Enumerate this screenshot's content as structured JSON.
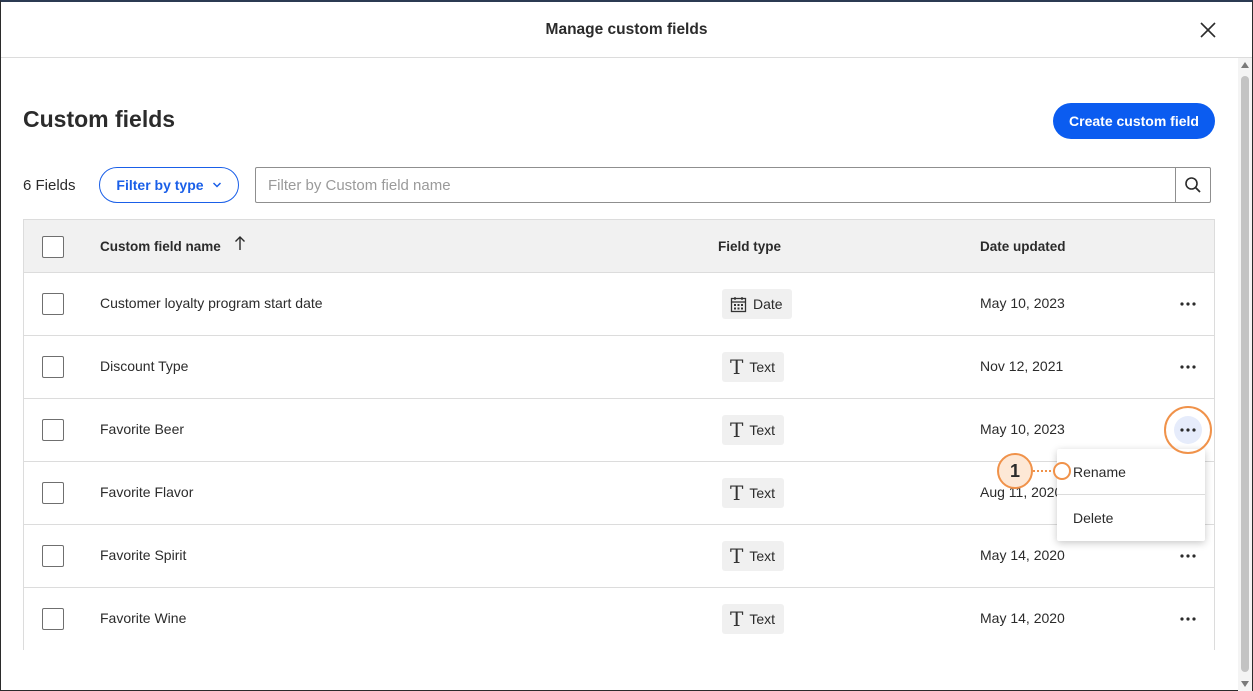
{
  "dialog": {
    "title": "Manage custom fields"
  },
  "page": {
    "title": "Custom fields",
    "create_label": "Create custom field",
    "field_count": "6 Fields",
    "filter_type_label": "Filter by type",
    "search_placeholder": "Filter by Custom field name"
  },
  "table": {
    "headers": {
      "name": "Custom field name",
      "type": "Field type",
      "date": "Date updated"
    },
    "rows": [
      {
        "name": "Customer loyalty program start date",
        "type": "Date",
        "type_icon": "calendar-icon",
        "date": "May 10, 2023"
      },
      {
        "name": "Discount Type",
        "type": "Text",
        "type_icon": "text-icon",
        "date": "Nov 12, 2021"
      },
      {
        "name": "Favorite Beer",
        "type": "Text",
        "type_icon": "text-icon",
        "date": "May 10, 2023"
      },
      {
        "name": "Favorite Flavor",
        "type": "Text",
        "type_icon": "text-icon",
        "date": "Aug 11, 2020"
      },
      {
        "name": "Favorite Spirit",
        "type": "Text",
        "type_icon": "text-icon",
        "date": "May 14, 2020"
      },
      {
        "name": "Favorite Wine",
        "type": "Text",
        "type_icon": "text-icon",
        "date": "May 14, 2020"
      }
    ]
  },
  "menu": {
    "rename": "Rename",
    "delete": "Delete"
  },
  "callout": {
    "step": "1"
  },
  "colors": {
    "primary": "#0b5cf0",
    "callout": "#f0924a"
  }
}
